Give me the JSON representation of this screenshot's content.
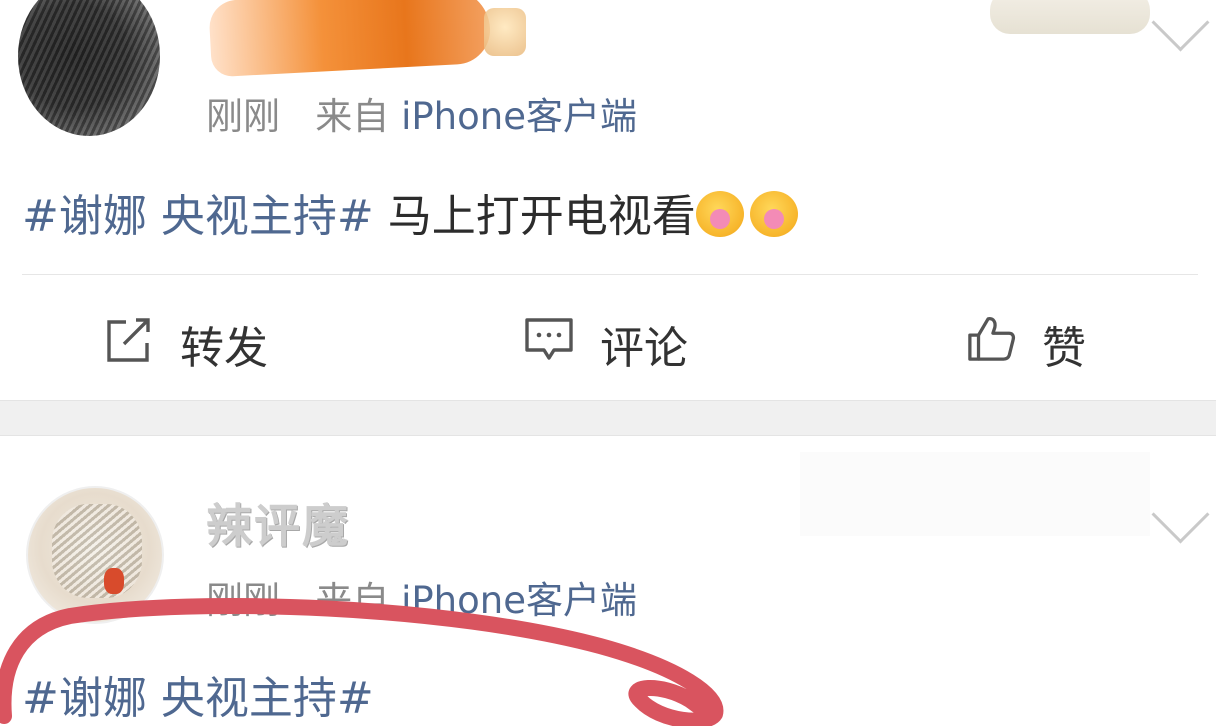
{
  "post1": {
    "time": "刚刚",
    "source_prefix": "来自",
    "source": "iPhone客户端",
    "hashtag": "#谢娜 央视主持#",
    "text": " 马上打开电视看",
    "emoji_icons": [
      "flower-smile-emoji",
      "flower-smile-emoji"
    ],
    "actions": {
      "repost": "转发",
      "comment": "评论",
      "like": "赞"
    }
  },
  "post2": {
    "name": "辣评魔",
    "time": "刚刚",
    "source_prefix": "来自",
    "source": "iPhone客户端",
    "hashtag": "#谢娜 央视主持#"
  },
  "colors": {
    "link": "#4f6890",
    "meta": "#8a8a8a",
    "annotation": "#d9545f"
  }
}
